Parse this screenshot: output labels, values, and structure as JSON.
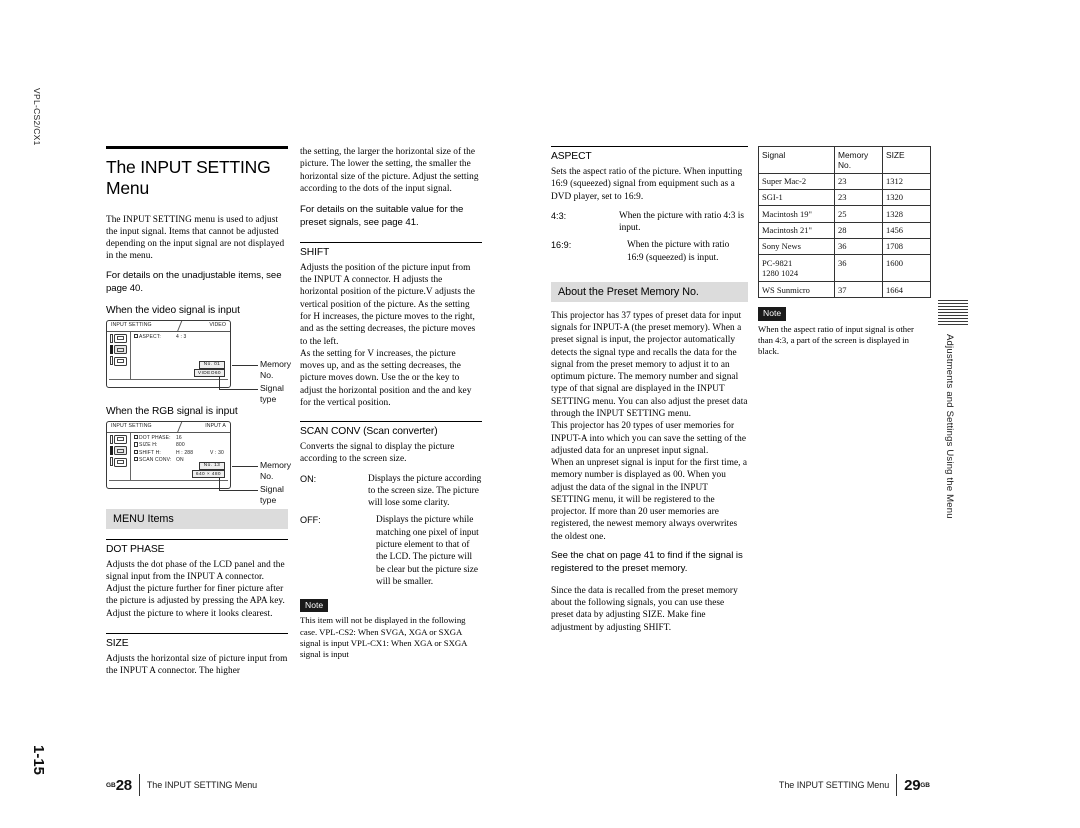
{
  "margins": {
    "model_label": "VPL-CS2/CX1",
    "sheet_label": "1-15",
    "side_tab_text": "Adjustments and Settings Using the Menu"
  },
  "col1": {
    "title": "The INPUT SETTING Menu",
    "intro": "The INPUT SETTING menu is used to adjust the input signal. Items that cannot be adjusted depending on the input signal are not displayed in the menu.",
    "see_page_40": "For details on the unadjustable items, see page 40.",
    "video_heading": "When the video signal is input",
    "rgb_heading": "When the RGB signal is input",
    "menu_items_heading": "MENU Items",
    "dot_phase_head": "DOT PHASE",
    "dot_phase_body": "Adjusts the dot phase of the LCD panel and the signal input from the INPUT A connector. Adjust the picture further for finer picture after the picture is adjusted by pressing the APA key. Adjust the picture to where it looks clearest.",
    "size_head": "SIZE",
    "size_body": "Adjusts the horizontal size of picture input from the INPUT A connector. The higher",
    "osd_video": {
      "title": "INPUT SETTING",
      "input": "VIDEO",
      "rows": [
        {
          "label": "ASPECT:",
          "value": "4 : 3",
          "value2": ""
        }
      ],
      "memory_no": "No.  01",
      "signal_type": "VIDEO60",
      "callout_memory": "Memory\nNo.",
      "callout_signal": "Signal\ntype"
    },
    "osd_rgb": {
      "title": "INPUT SETTING",
      "input": "INPUT A",
      "rows": [
        {
          "label": "DOT PHASE:",
          "value": "16",
          "value2": ""
        },
        {
          "label": "SIZE H:",
          "value": "800",
          "value2": ""
        },
        {
          "label": "SHIFT H:",
          "value": "H : 288",
          "value2": "V : 30"
        },
        {
          "label": "SCAN CONV:",
          "value": "ON",
          "value2": ""
        }
      ],
      "memory_no": "No.   13",
      "signal_type": "640 × 480",
      "callout_memory": "Memory\nNo.",
      "callout_signal": "Signal\ntype"
    },
    "callout_memory_l1": "Memory",
    "callout_memory_l2": "No.",
    "callout_signal_l1": "Signal",
    "callout_signal_l2": "type"
  },
  "col2": {
    "size_cont": "the setting, the larger the horizontal size of the picture. The lower the setting, the smaller the horizontal size of the picture. Adjust the setting according to the dots of the input signal.",
    "preset_note": "For details on the suitable value for the preset signals, see page 41.",
    "shift_head": "SHIFT",
    "shift_body1": "Adjusts the position of the picture input from the INPUT A connector. H adjusts the horizontal position of the picture.V adjusts the vertical position of the picture. As the setting for H increases, the picture moves to the right, and as the setting decreases, the picture moves to the left.",
    "shift_body2": "As the setting for V increases, the picture moves up, and as the setting decreases, the picture moves down. Use the        or the       key to adjust the horizontal position and the       and      key for the vertical position.",
    "scan_conv_head": "SCAN CONV (Scan converter)",
    "scan_conv_body": "Converts the signal to display the picture according to the screen size.",
    "scan_on_term": "ON:",
    "scan_on_def": "Displays the picture according to the screen size. The picture will lose some clarity.",
    "scan_off_term": "OFF:",
    "scan_off_def": "Displays the picture while matching one pixel of input picture element to that of the LCD. The picture will be clear but the picture size will be smaller.",
    "note_badge": "Note",
    "note_text": "This item will not be displayed in the following case. VPL-CS2: When SVGA, XGA or SXGA signal is input VPL-CX1: When XGA or SXGA signal is input"
  },
  "col3": {
    "aspect_head": "ASPECT",
    "aspect_body": "Sets the aspect ratio of the picture. When inputting 16:9 (squeezed) signal from equipment such as a DVD player, set to 16:9.",
    "aspect_43_term": "4:3:",
    "aspect_43_def": "When the picture with ratio 4:3 is input.",
    "aspect_169_term": "16:9:",
    "aspect_169_def": "When the picture with ratio 16:9 (squeezed) is input.",
    "preset_head": "About the Preset Memory No.",
    "preset_body1": "This projector has 37 types of preset data for input signals for INPUT-A (the preset memory). When a preset signal is input, the projector automatically detects the signal type and recalls the data for the signal from the preset memory to adjust it to an optimum picture. The memory number and signal type of that signal are displayed in the INPUT SETTING menu. You can also adjust the preset data through the INPUT SETTING menu.",
    "preset_body2": "This projector has 20 types of user memories for INPUT-A into which you can save the setting of the adjusted data for an unpreset input signal.",
    "preset_body3": "When an unpreset signal is input for the first time, a memory number is displayed as 00. When you adjust the data of the signal in the INPUT SETTING menu, it will be registered to the projector. If more than 20 user memories are registered, the newest memory always overwrites the oldest one.",
    "chart_ref": "See the chat on page 41 to find if the signal is registered to the preset memory.",
    "preset_body4": "Since the data is recalled from the preset memory about the following signals, you can use these preset data by adjusting SIZE. Make fine adjustment by adjusting SHIFT."
  },
  "col4": {
    "table": {
      "headers": [
        "Signal",
        "Memory No.",
        "SIZE"
      ],
      "rows": [
        {
          "signal": "Super Mac-2",
          "signal2": "",
          "memory": "23",
          "size": "1312"
        },
        {
          "signal": "SGI-1",
          "signal2": "",
          "memory": "23",
          "size": "1320"
        },
        {
          "signal": "Macintosh 19\"",
          "signal2": "",
          "memory": "25",
          "size": "1328"
        },
        {
          "signal": "Macintosh 21\"",
          "signal2": "",
          "memory": "28",
          "size": "1456"
        },
        {
          "signal": "Sony News",
          "signal2": "",
          "memory": "36",
          "size": "1708"
        },
        {
          "signal": "PC-9821",
          "signal2": "1280    1024",
          "memory": "36",
          "size": "1600"
        },
        {
          "signal": "WS Sunmicro",
          "signal2": "",
          "memory": "37",
          "size": "1664"
        }
      ]
    },
    "note_badge": "Note",
    "note_text": "When the aspect ratio of input signal is other than 4:3, a part of the screen is displayed in black."
  },
  "footer": {
    "left_page": "28",
    "left_sup": "GB",
    "left_text": "The INPUT SETTING Menu",
    "right_text": "The INPUT SETTING Menu",
    "right_page": "29",
    "right_sup": "GB"
  }
}
